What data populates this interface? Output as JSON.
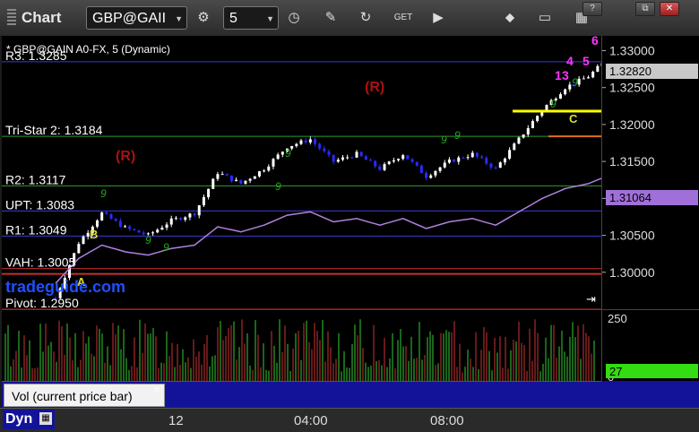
{
  "toolbar": {
    "app_title": "Chart",
    "symbol": "GBP@GAII",
    "interval": "5",
    "icons": [
      "gear-icon",
      "clock-icon",
      "pencil-icon",
      "refresh-icon",
      "get-icon",
      "play-icon",
      "tag-icon",
      "comment-icon",
      "grid-icon"
    ]
  },
  "window": {
    "help": "?",
    "restore": "⧉",
    "close": "✕"
  },
  "chart": {
    "header": "* GBP@GAIN A0-FX, 5 (Dynamic)",
    "levels": [
      {
        "label": "R3: 1.3285",
        "price": 1.3285,
        "color": "#3b3bd6"
      },
      {
        "label": "Tri-Star 2: 1.3184",
        "price": 1.3184,
        "color": "#2e9c2e"
      },
      {
        "label": "R2: 1.3117",
        "price": 1.3117,
        "color": "#2e9c2e"
      },
      {
        "label": "UPT: 1.3083",
        "price": 1.3083,
        "color": "#3b3bd6"
      },
      {
        "label": "R1: 1.3049",
        "price": 1.3049,
        "color": "#3b3bd6"
      },
      {
        "label": "VAH: 1.3005",
        "price": 1.3005,
        "color": "#c03030"
      },
      {
        "label": "Pivot: 1.2950",
        "price": 1.295,
        "color": "#c03030"
      }
    ],
    "annotations": [
      "(R)",
      "(R)",
      "B",
      "A",
      "C",
      "1",
      "3",
      "4",
      "5",
      "6"
    ],
    "watermark": "tradeguide.com",
    "current_price": "1.32820",
    "ma_value": "1.31064",
    "price_ticks": [
      "1.33000",
      "1.32500",
      "1.32000",
      "1.31500",
      "1.31000",
      "1.30500",
      "1.30000"
    ],
    "colors": {
      "up": "#ffffff",
      "down": "#2a2aff",
      "ma": "#b080e0",
      "seq": "#22aa22",
      "magenta": "#ff33ff",
      "target": "#ffff00"
    }
  },
  "volume": {
    "ticks": [
      "250",
      "0"
    ],
    "current": "27",
    "study_label": "Vol (current price bar)",
    "close": "×"
  },
  "time_axis": {
    "labels": [
      "12",
      "04:00",
      "08:00"
    ],
    "dyn": "Dyn"
  },
  "chart_data": {
    "type": "line",
    "series": [
      {
        "x": [
          0,
          5,
          10,
          15,
          20,
          25,
          30,
          35,
          40,
          45,
          50,
          55,
          60,
          65,
          70,
          75,
          80,
          85,
          90,
          95,
          100,
          105,
          110,
          115,
          118
        ],
        "values": [
          1.2965,
          1.304,
          1.308,
          1.306,
          1.305,
          1.307,
          1.308,
          1.3135,
          1.312,
          1.314,
          1.317,
          1.318,
          1.315,
          1.316,
          1.314,
          1.316,
          1.313,
          1.315,
          1.316,
          1.314,
          1.318,
          1.322,
          1.325,
          1.3265,
          1.3282
        ]
      }
    ],
    "ylim": [
      1.295,
      1.332
    ]
  }
}
